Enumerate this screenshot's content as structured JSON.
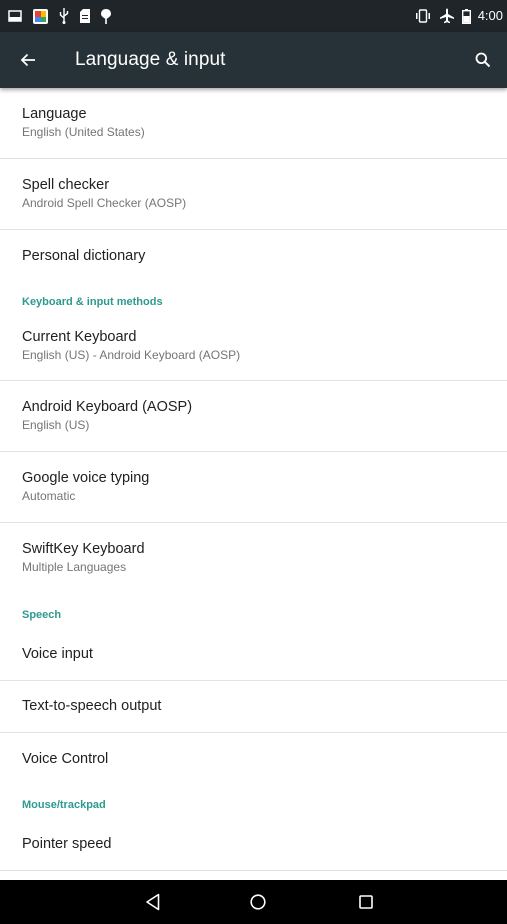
{
  "status_bar": {
    "left_icons": [
      "screenshot-icon",
      "photos-app-icon",
      "usb-icon",
      "sd-card-icon",
      "location-pin-icon"
    ],
    "right_icons": [
      "vibrate-icon",
      "airplane-mode-icon",
      "battery-icon"
    ],
    "time": "4:00"
  },
  "toolbar": {
    "title": "Language & input",
    "back_icon": "arrow-back-icon",
    "search_icon": "search-icon",
    "background": "#263238"
  },
  "settings": {
    "language": {
      "title": "Language",
      "summary": "English (United States)"
    },
    "spell_checker": {
      "title": "Spell checker",
      "summary": "Android Spell Checker (AOSP)"
    },
    "personal_dictionary": {
      "title": "Personal dictionary"
    },
    "keyboard_category": "Keyboard & input methods",
    "current_keyboard": {
      "title": "Current Keyboard",
      "summary": "English (US) - Android Keyboard (AOSP)"
    },
    "android_keyboard": {
      "title": "Android Keyboard (AOSP)",
      "summary": "English (US)"
    },
    "google_voice_typing": {
      "title": "Google voice typing",
      "summary": "Automatic"
    },
    "swiftkey_keyboard": {
      "title": "SwiftKey Keyboard",
      "summary": "Multiple Languages"
    },
    "speech_category": "Speech",
    "voice_input": {
      "title": "Voice input"
    },
    "tts_output": {
      "title": "Text-to-speech output"
    },
    "voice_control": {
      "title": "Voice Control"
    },
    "mouse_category": "Mouse/trackpad",
    "pointer_speed": {
      "title": "Pointer speed"
    }
  },
  "nav_bar": {
    "buttons": [
      "back-nav-icon",
      "home-nav-icon",
      "recents-nav-icon"
    ]
  },
  "colors": {
    "accent": "#2d9a8e",
    "status_bar": "#1f2529",
    "divider": "#e3e3e3"
  }
}
